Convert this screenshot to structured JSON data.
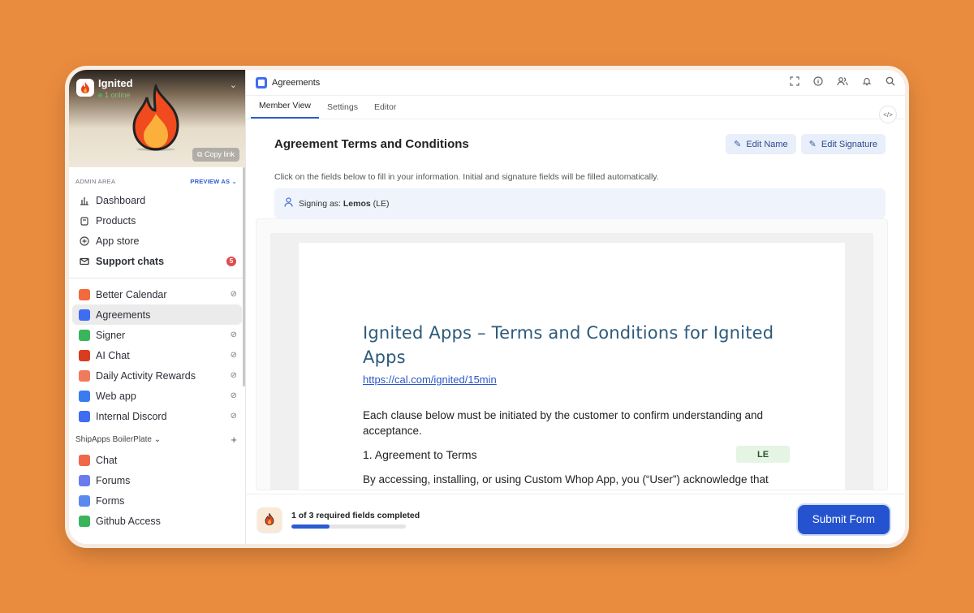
{
  "workspace": {
    "name": "Ignited",
    "online": "1 online",
    "copy_link": "Copy link"
  },
  "sidebar": {
    "admin_label": "ADMIN AREA",
    "preview_label": "PREVIEW AS",
    "main_items": [
      {
        "label": "Dashboard",
        "icon": "chart-icon"
      },
      {
        "label": "Products",
        "icon": "box-icon"
      },
      {
        "label": "App store",
        "icon": "plus-circle-icon"
      },
      {
        "label": "Support chats",
        "icon": "mail-icon",
        "badge": "5"
      }
    ],
    "apps": [
      {
        "label": "Better Calendar",
        "color": "#f26a3d"
      },
      {
        "label": "Agreements",
        "color": "#3d6df0"
      },
      {
        "label": "Signer",
        "color": "#3ab55c"
      },
      {
        "label": "AI Chat",
        "color": "#d93c1f"
      },
      {
        "label": "Daily Activity Rewards",
        "color": "#f07b5a"
      },
      {
        "label": "Web app",
        "color": "#3a7bf0"
      },
      {
        "label": "Internal Discord",
        "color": "#3d6df0"
      }
    ],
    "group_label": "ShipApps BoilerPlate",
    "group_items": [
      {
        "label": "Chat",
        "color": "#f0684a"
      },
      {
        "label": "Forums",
        "color": "#6a7bf0"
      },
      {
        "label": "Forms",
        "color": "#5a8af0"
      },
      {
        "label": "Github Access",
        "color": "#3ab55c"
      }
    ]
  },
  "topbar": {
    "title": "Agreements"
  },
  "tabs": [
    "Member View",
    "Settings",
    "Editor"
  ],
  "page": {
    "title": "Agreement Terms and Conditions",
    "edit_name": "Edit Name",
    "edit_signature": "Edit Signature",
    "hint": "Click on the fields below to fill in your information. Initial and signature fields will be filled automatically.",
    "signing_prefix": "Signing as:",
    "signing_name": "Lemos",
    "signing_initials": "(LE)"
  },
  "document": {
    "title": "Ignited Apps – Terms and Conditions for Ignited Apps",
    "link": "https://cal.com/ignited/15min",
    "intro": "Each clause below must be initiated by the customer to confirm understanding and acceptance.",
    "section_heading": "1. Agreement to Terms",
    "initials_box": "LE",
    "section_text": "By accessing, installing, or using Custom Whop App, you (“User”) acknowledge that you have read, understood, and agree to be bound by these Terms and Conditions."
  },
  "footer": {
    "progress_text": "1 of 3 required fields completed",
    "progress_fraction": 0.33,
    "submit_label": "Submit Form"
  }
}
